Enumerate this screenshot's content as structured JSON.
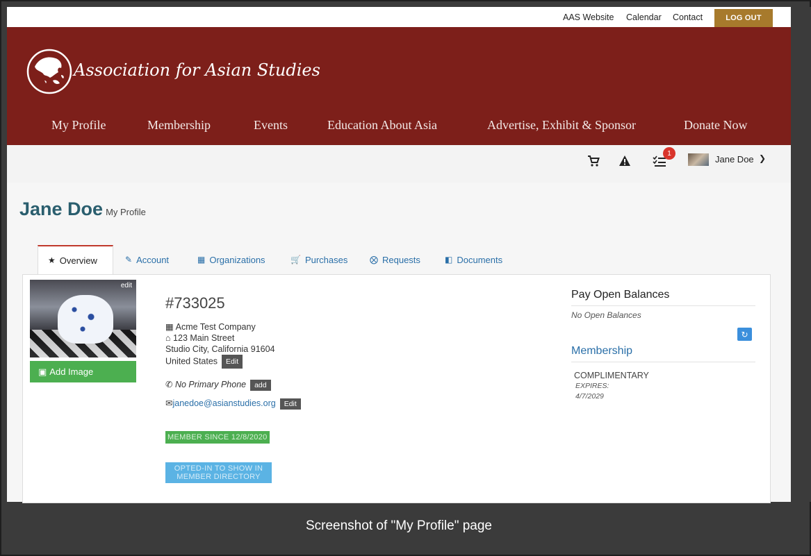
{
  "util_links": {
    "aas_website": "AAS Website",
    "calendar": "Calendar",
    "contact": "Contact",
    "logout": "LOG OUT"
  },
  "brand": {
    "name": "Association for Asian Studies",
    "primary_color": "#7d1f1a",
    "accent_color": "#a77a2c"
  },
  "nav": [
    "My Profile",
    "Membership",
    "Events",
    "Education About Asia",
    "Advertise, Exhibit & Sponsor",
    "Donate Now"
  ],
  "userbar": {
    "cart_icon": "cart-icon",
    "alert_icon": "warning-icon",
    "tasks_icon": "tasks-icon",
    "task_count": "1",
    "user_name": "Jane Doe"
  },
  "page": {
    "title": "Jane Doe",
    "subtitle": "My Profile"
  },
  "tabs": [
    {
      "label": "Overview",
      "icon": "star-icon",
      "active": true
    },
    {
      "label": "Account",
      "icon": "edit-icon"
    },
    {
      "label": "Organizations",
      "icon": "building-icon"
    },
    {
      "label": "Purchases",
      "icon": "cart-icon"
    },
    {
      "label": "Requests",
      "icon": "x-circle-icon"
    },
    {
      "label": "Documents",
      "icon": "documents-icon"
    }
  ],
  "profile": {
    "photo_edit": "edit",
    "add_image": "Add Image",
    "member_number": "#733025",
    "company": "Acme Test Company",
    "street": "123 Main Street",
    "city_state_zip": "Studio City, California 91604",
    "country": "United States",
    "edit_label": "Edit",
    "phone": "No Primary Phone",
    "add_label": "add",
    "email": "janedoe@asianstudies.org",
    "email_edit": "Edit",
    "member_since": "MEMBER SINCE 12/8/2020",
    "opted_in": "OPTED-IN TO SHOW IN MEMBER DIRECTORY"
  },
  "sidebar": {
    "balances_title": "Pay Open Balances",
    "balances_text": "No Open Balances",
    "membership_title": "Membership",
    "membership_type": "COMPLIMENTARY",
    "expires_label": "EXPIRES:",
    "expires_date": "4/7/2029"
  },
  "caption": "Screenshot of \"My Profile\" page"
}
